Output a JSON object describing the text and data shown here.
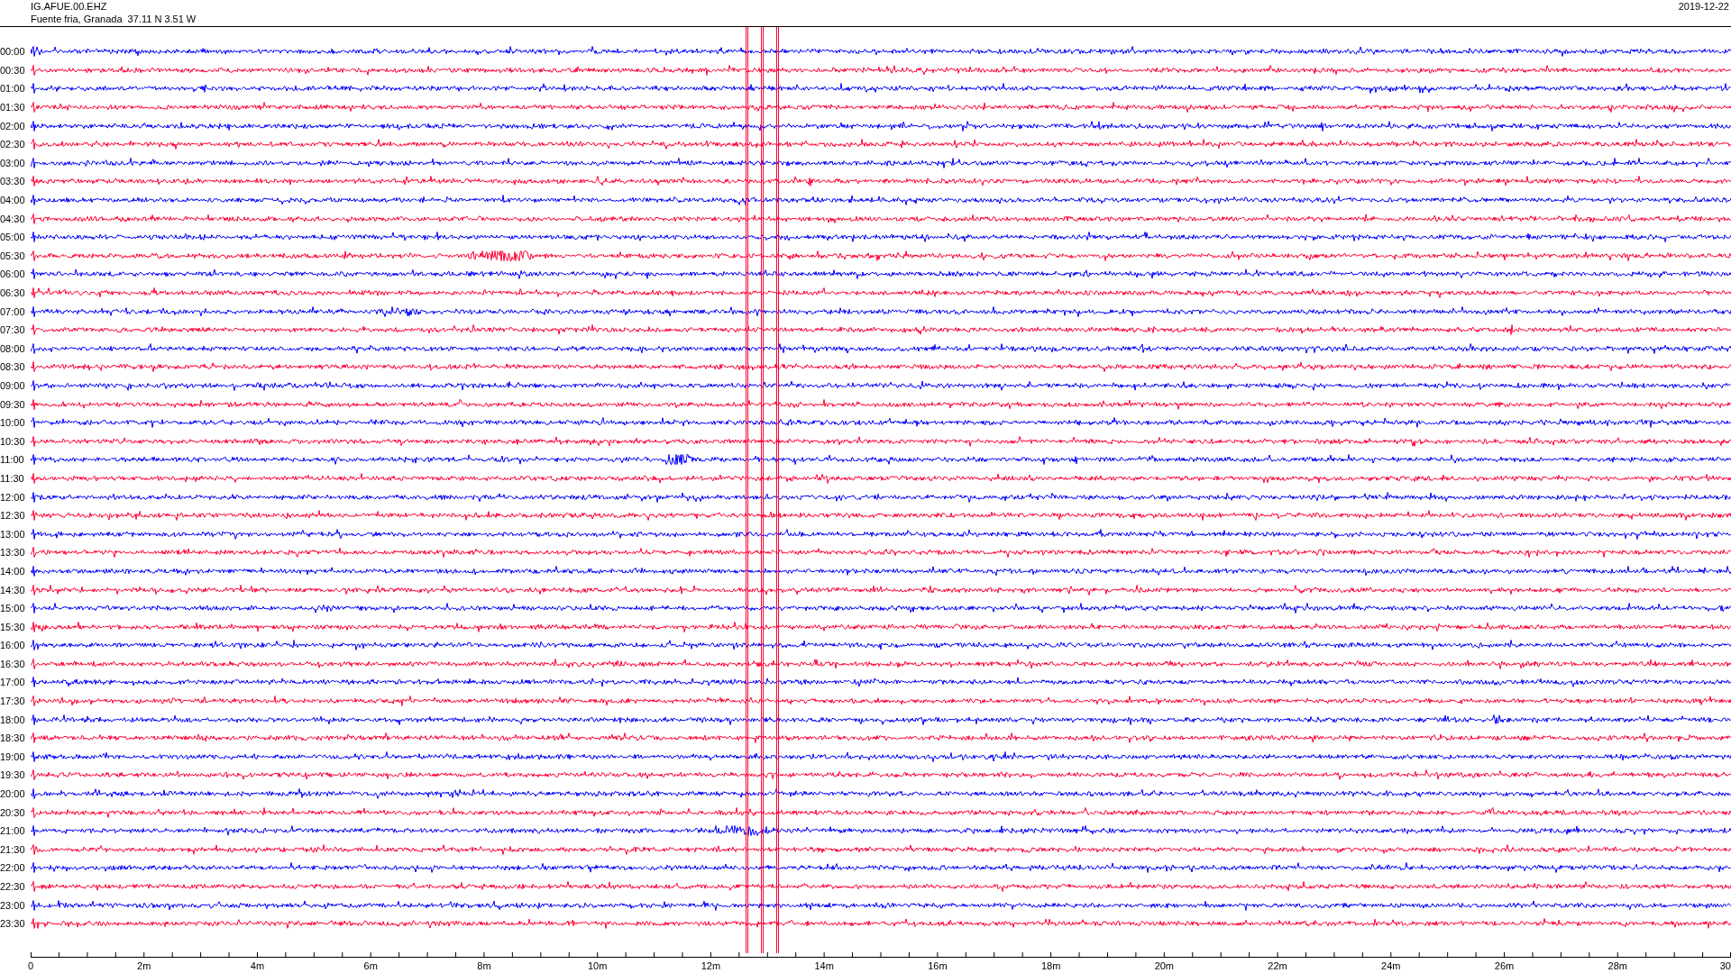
{
  "header": {
    "station": "IG.AFUE.00.EHZ",
    "location": "Fuente fria, Granada  37.11 N 3.51 W",
    "date": "2019-12-22"
  },
  "rows": [
    {
      "time": "00:00",
      "color": "#0000ff"
    },
    {
      "time": "00:30",
      "color": "#ff0033"
    },
    {
      "time": "01:00",
      "color": "#0000ff"
    },
    {
      "time": "01:30",
      "color": "#ff0033"
    },
    {
      "time": "02:00",
      "color": "#0000ff"
    },
    {
      "time": "02:30",
      "color": "#ff0033"
    },
    {
      "time": "03:00",
      "color": "#0000ff"
    },
    {
      "time": "03:30",
      "color": "#ff0033"
    },
    {
      "time": "04:00",
      "color": "#0000ff"
    },
    {
      "time": "04:30",
      "color": "#ff0033"
    },
    {
      "time": "05:00",
      "color": "#0000ff"
    },
    {
      "time": "05:30",
      "color": "#ff0033"
    },
    {
      "time": "06:00",
      "color": "#0000ff"
    },
    {
      "time": "06:30",
      "color": "#ff0033"
    },
    {
      "time": "07:00",
      "color": "#0000ff"
    },
    {
      "time": "07:30",
      "color": "#ff0033"
    },
    {
      "time": "08:00",
      "color": "#0000ff"
    },
    {
      "time": "08:30",
      "color": "#ff0033"
    },
    {
      "time": "09:00",
      "color": "#0000ff"
    },
    {
      "time": "09:30",
      "color": "#ff0033"
    },
    {
      "time": "10:00",
      "color": "#0000ff"
    },
    {
      "time": "10:30",
      "color": "#ff0033"
    },
    {
      "time": "11:00",
      "color": "#0000ff"
    },
    {
      "time": "11:30",
      "color": "#ff0033"
    },
    {
      "time": "12:00",
      "color": "#0000ff"
    },
    {
      "time": "12:30",
      "color": "#ff0033"
    },
    {
      "time": "13:00",
      "color": "#0000ff"
    },
    {
      "time": "13:30",
      "color": "#ff0033"
    },
    {
      "time": "14:00",
      "color": "#0000ff"
    },
    {
      "time": "14:30",
      "color": "#ff0033"
    },
    {
      "time": "15:00",
      "color": "#0000ff"
    },
    {
      "time": "15:30",
      "color": "#ff0033"
    },
    {
      "time": "16:00",
      "color": "#0000ff"
    },
    {
      "time": "16:30",
      "color": "#ff0033"
    },
    {
      "time": "17:00",
      "color": "#0000ff"
    },
    {
      "time": "17:30",
      "color": "#ff0033"
    },
    {
      "time": "18:00",
      "color": "#0000ff"
    },
    {
      "time": "18:30",
      "color": "#ff0033"
    },
    {
      "time": "19:00",
      "color": "#0000ff"
    },
    {
      "time": "19:30",
      "color": "#ff0033"
    },
    {
      "time": "20:00",
      "color": "#0000ff"
    },
    {
      "time": "20:30",
      "color": "#ff0033"
    },
    {
      "time": "21:00",
      "color": "#0000ff"
    },
    {
      "time": "21:30",
      "color": "#ff0033"
    },
    {
      "time": "22:00",
      "color": "#0000ff"
    },
    {
      "time": "22:30",
      "color": "#ff0033"
    },
    {
      "time": "23:00",
      "color": "#0000ff"
    },
    {
      "time": "23:30",
      "color": "#ff0033"
    }
  ],
  "x_axis": {
    "labels": [
      "0",
      "2m",
      "4m",
      "6m",
      "8m",
      "10m",
      "12m",
      "14m",
      "16m",
      "18m",
      "20m",
      "22m",
      "24m",
      "26m",
      "28m",
      "30"
    ]
  }
}
